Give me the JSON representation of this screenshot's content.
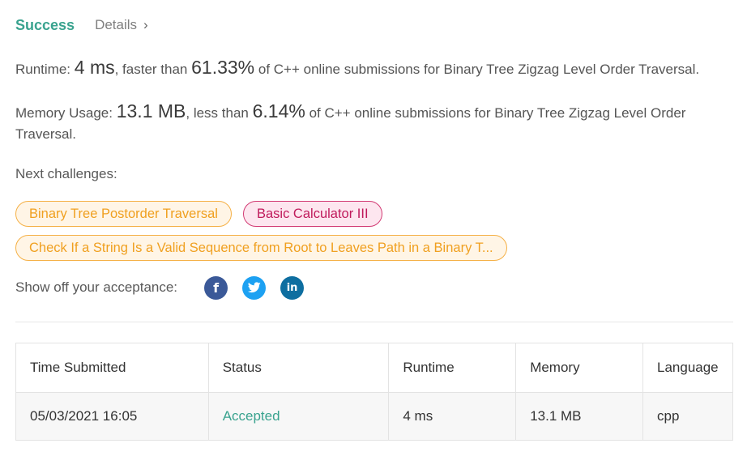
{
  "result": {
    "status": "Success",
    "details_label": "Details",
    "details_chevron": "›"
  },
  "runtime": {
    "label": "Runtime:",
    "value": "4 ms",
    "mid": ", faster than",
    "percent": "61.33%",
    "tail": "of C++ online submissions for Binary Tree Zigzag Level Order Traversal."
  },
  "memory": {
    "label": "Memory Usage:",
    "value": "13.1 MB",
    "mid": ", less than",
    "percent": "6.14%",
    "tail": "of C++ online submissions for Binary Tree Zigzag Level Order Traversal."
  },
  "next_challenges": {
    "title": "Next challenges:",
    "items": [
      {
        "label": "Binary Tree Postorder Traversal",
        "difficulty": "medium"
      },
      {
        "label": "Basic Calculator III",
        "difficulty": "hard"
      },
      {
        "label": "Check If a String Is a Valid Sequence from Root to Leaves Path in a Binary T...",
        "difficulty": "medium"
      }
    ]
  },
  "share": {
    "label": "Show off your acceptance:",
    "icons": [
      {
        "name": "facebook-icon",
        "glyph": "f"
      },
      {
        "name": "twitter-icon",
        "glyph": "🐦"
      },
      {
        "name": "linkedin-icon",
        "glyph": "in"
      }
    ]
  },
  "submissions": {
    "columns": [
      "Time Submitted",
      "Status",
      "Runtime",
      "Memory",
      "Language"
    ],
    "rows": [
      {
        "time": "05/03/2021 16:05",
        "status": "Accepted",
        "runtime": "4 ms",
        "memory": "13.1 MB",
        "language": "cpp"
      }
    ]
  },
  "colors": {
    "success": "#3aa38f",
    "medium": "#f0a020",
    "hard": "#c01b5c",
    "facebook": "#3b5998",
    "twitter": "#1da1f2",
    "linkedin": "#0e6ea0"
  }
}
